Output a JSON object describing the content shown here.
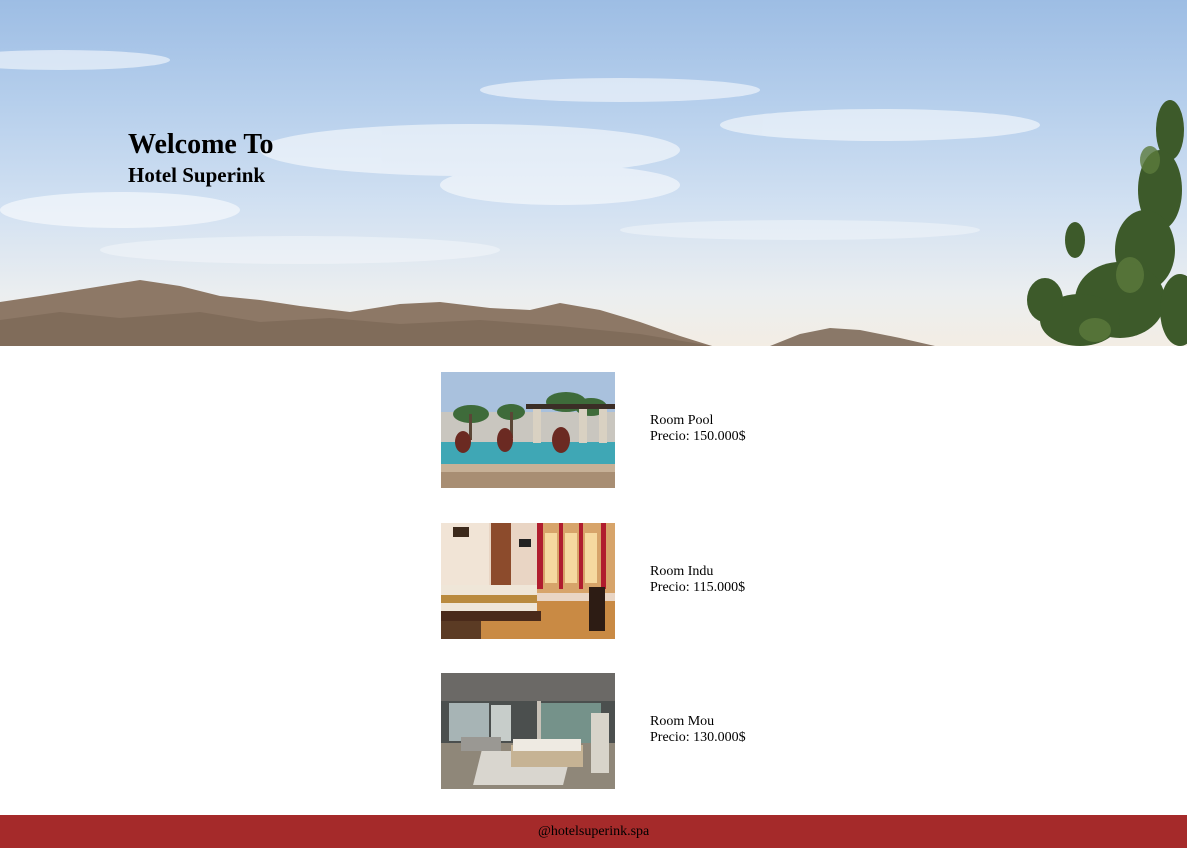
{
  "hero": {
    "title": "Welcome To",
    "subtitle": "Hotel Superink"
  },
  "rooms": [
    {
      "name": "Room Pool",
      "price": "Precio: 150.000$",
      "photo": "pool-photo"
    },
    {
      "name": "Room Indu",
      "price": "Precio: 115.000$",
      "photo": "bedroom-photo"
    },
    {
      "name": "Room Mou",
      "price": "Precio: 130.000$",
      "photo": "suite-photo"
    }
  ],
  "footer": {
    "handle": "@hotelsuperink.spa",
    "color": "#a52a2a"
  }
}
